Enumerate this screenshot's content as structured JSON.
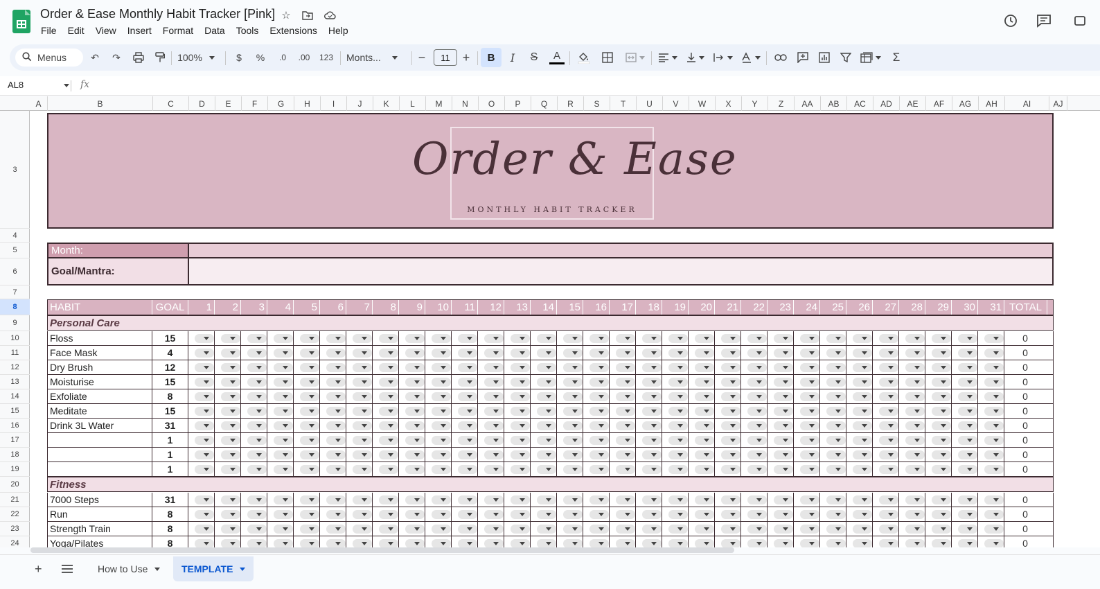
{
  "doc": {
    "title": "Order & Ease Monthly Habit Tracker [Pink]",
    "menu": [
      "File",
      "Edit",
      "View",
      "Insert",
      "Format",
      "Data",
      "Tools",
      "Extensions",
      "Help"
    ]
  },
  "toolbar": {
    "menus_label": "Menus",
    "zoom": "100%",
    "currency": "$",
    "percent": "%",
    "dec_less": ".0",
    "dec_more": ".00",
    "number_format": "123",
    "font": "Monts...",
    "font_size": "11",
    "bold": "B",
    "italic": "I",
    "strike": "S",
    "text_color": "A"
  },
  "formula_bar": {
    "name_box": "AL8",
    "fx": "fx"
  },
  "columns": [
    "A",
    "B",
    "C",
    "D",
    "E",
    "F",
    "G",
    "H",
    "I",
    "J",
    "K",
    "L",
    "M",
    "N",
    "O",
    "P",
    "Q",
    "R",
    "S",
    "T",
    "U",
    "V",
    "W",
    "X",
    "Y",
    "Z",
    "AA",
    "AB",
    "AC",
    "AD",
    "AE",
    "AF",
    "AG",
    "AH",
    "AI",
    "AJ"
  ],
  "rows": [
    "3",
    "4",
    "5",
    "6",
    "7",
    "8",
    "9",
    "10",
    "11",
    "12",
    "13",
    "14",
    "15",
    "16",
    "17",
    "18",
    "19",
    "20",
    "21",
    "22",
    "23",
    "24"
  ],
  "selected_row": "8",
  "banner": {
    "title": "Order & Ease",
    "subtitle": "MONTHLY HABIT TRACKER"
  },
  "month_label": "Month:",
  "goal_label": "Goal/Mantra:",
  "tracker": {
    "habit_header": "HABIT",
    "goal_header": "GOAL",
    "days": [
      "1",
      "2",
      "3",
      "4",
      "5",
      "6",
      "7",
      "8",
      "9",
      "10",
      "11",
      "12",
      "13",
      "14",
      "15",
      "16",
      "17",
      "18",
      "19",
      "20",
      "21",
      "22",
      "23",
      "24",
      "25",
      "26",
      "27",
      "28",
      "29",
      "30",
      "31"
    ],
    "total_header": "TOTAL",
    "sections": [
      {
        "name": "Personal Care",
        "habits": [
          {
            "habit": "Floss",
            "goal": "15",
            "total": "0"
          },
          {
            "habit": "Face Mask",
            "goal": "4",
            "total": "0"
          },
          {
            "habit": "Dry Brush",
            "goal": "12",
            "total": "0"
          },
          {
            "habit": "Moisturise",
            "goal": "15",
            "total": "0"
          },
          {
            "habit": "Exfoliate",
            "goal": "8",
            "total": "0"
          },
          {
            "habit": "Meditate",
            "goal": "15",
            "total": "0"
          },
          {
            "habit": "Drink 3L Water",
            "goal": "31",
            "total": "0"
          },
          {
            "habit": "",
            "goal": "1",
            "total": "0"
          },
          {
            "habit": "",
            "goal": "1",
            "total": "0"
          },
          {
            "habit": "",
            "goal": "1",
            "total": "0"
          }
        ]
      },
      {
        "name": "Fitness",
        "habits": [
          {
            "habit": "7000 Steps",
            "goal": "31",
            "total": "0"
          },
          {
            "habit": "Run",
            "goal": "8",
            "total": "0"
          },
          {
            "habit": "Strength Train",
            "goal": "8",
            "total": "0"
          },
          {
            "habit": "Yoga/Pilates",
            "goal": "8",
            "total": "0"
          }
        ]
      }
    ]
  },
  "sheet_tabs": [
    {
      "label": "How to Use",
      "active": false
    },
    {
      "label": "TEMPLATE",
      "active": true
    }
  ],
  "colors": {
    "accent": "#0b57d0",
    "banner": "#d9b6c3",
    "header_row": "#d9b3c1",
    "category": "#f2dfe6",
    "sheets_green": "#1fa463"
  }
}
